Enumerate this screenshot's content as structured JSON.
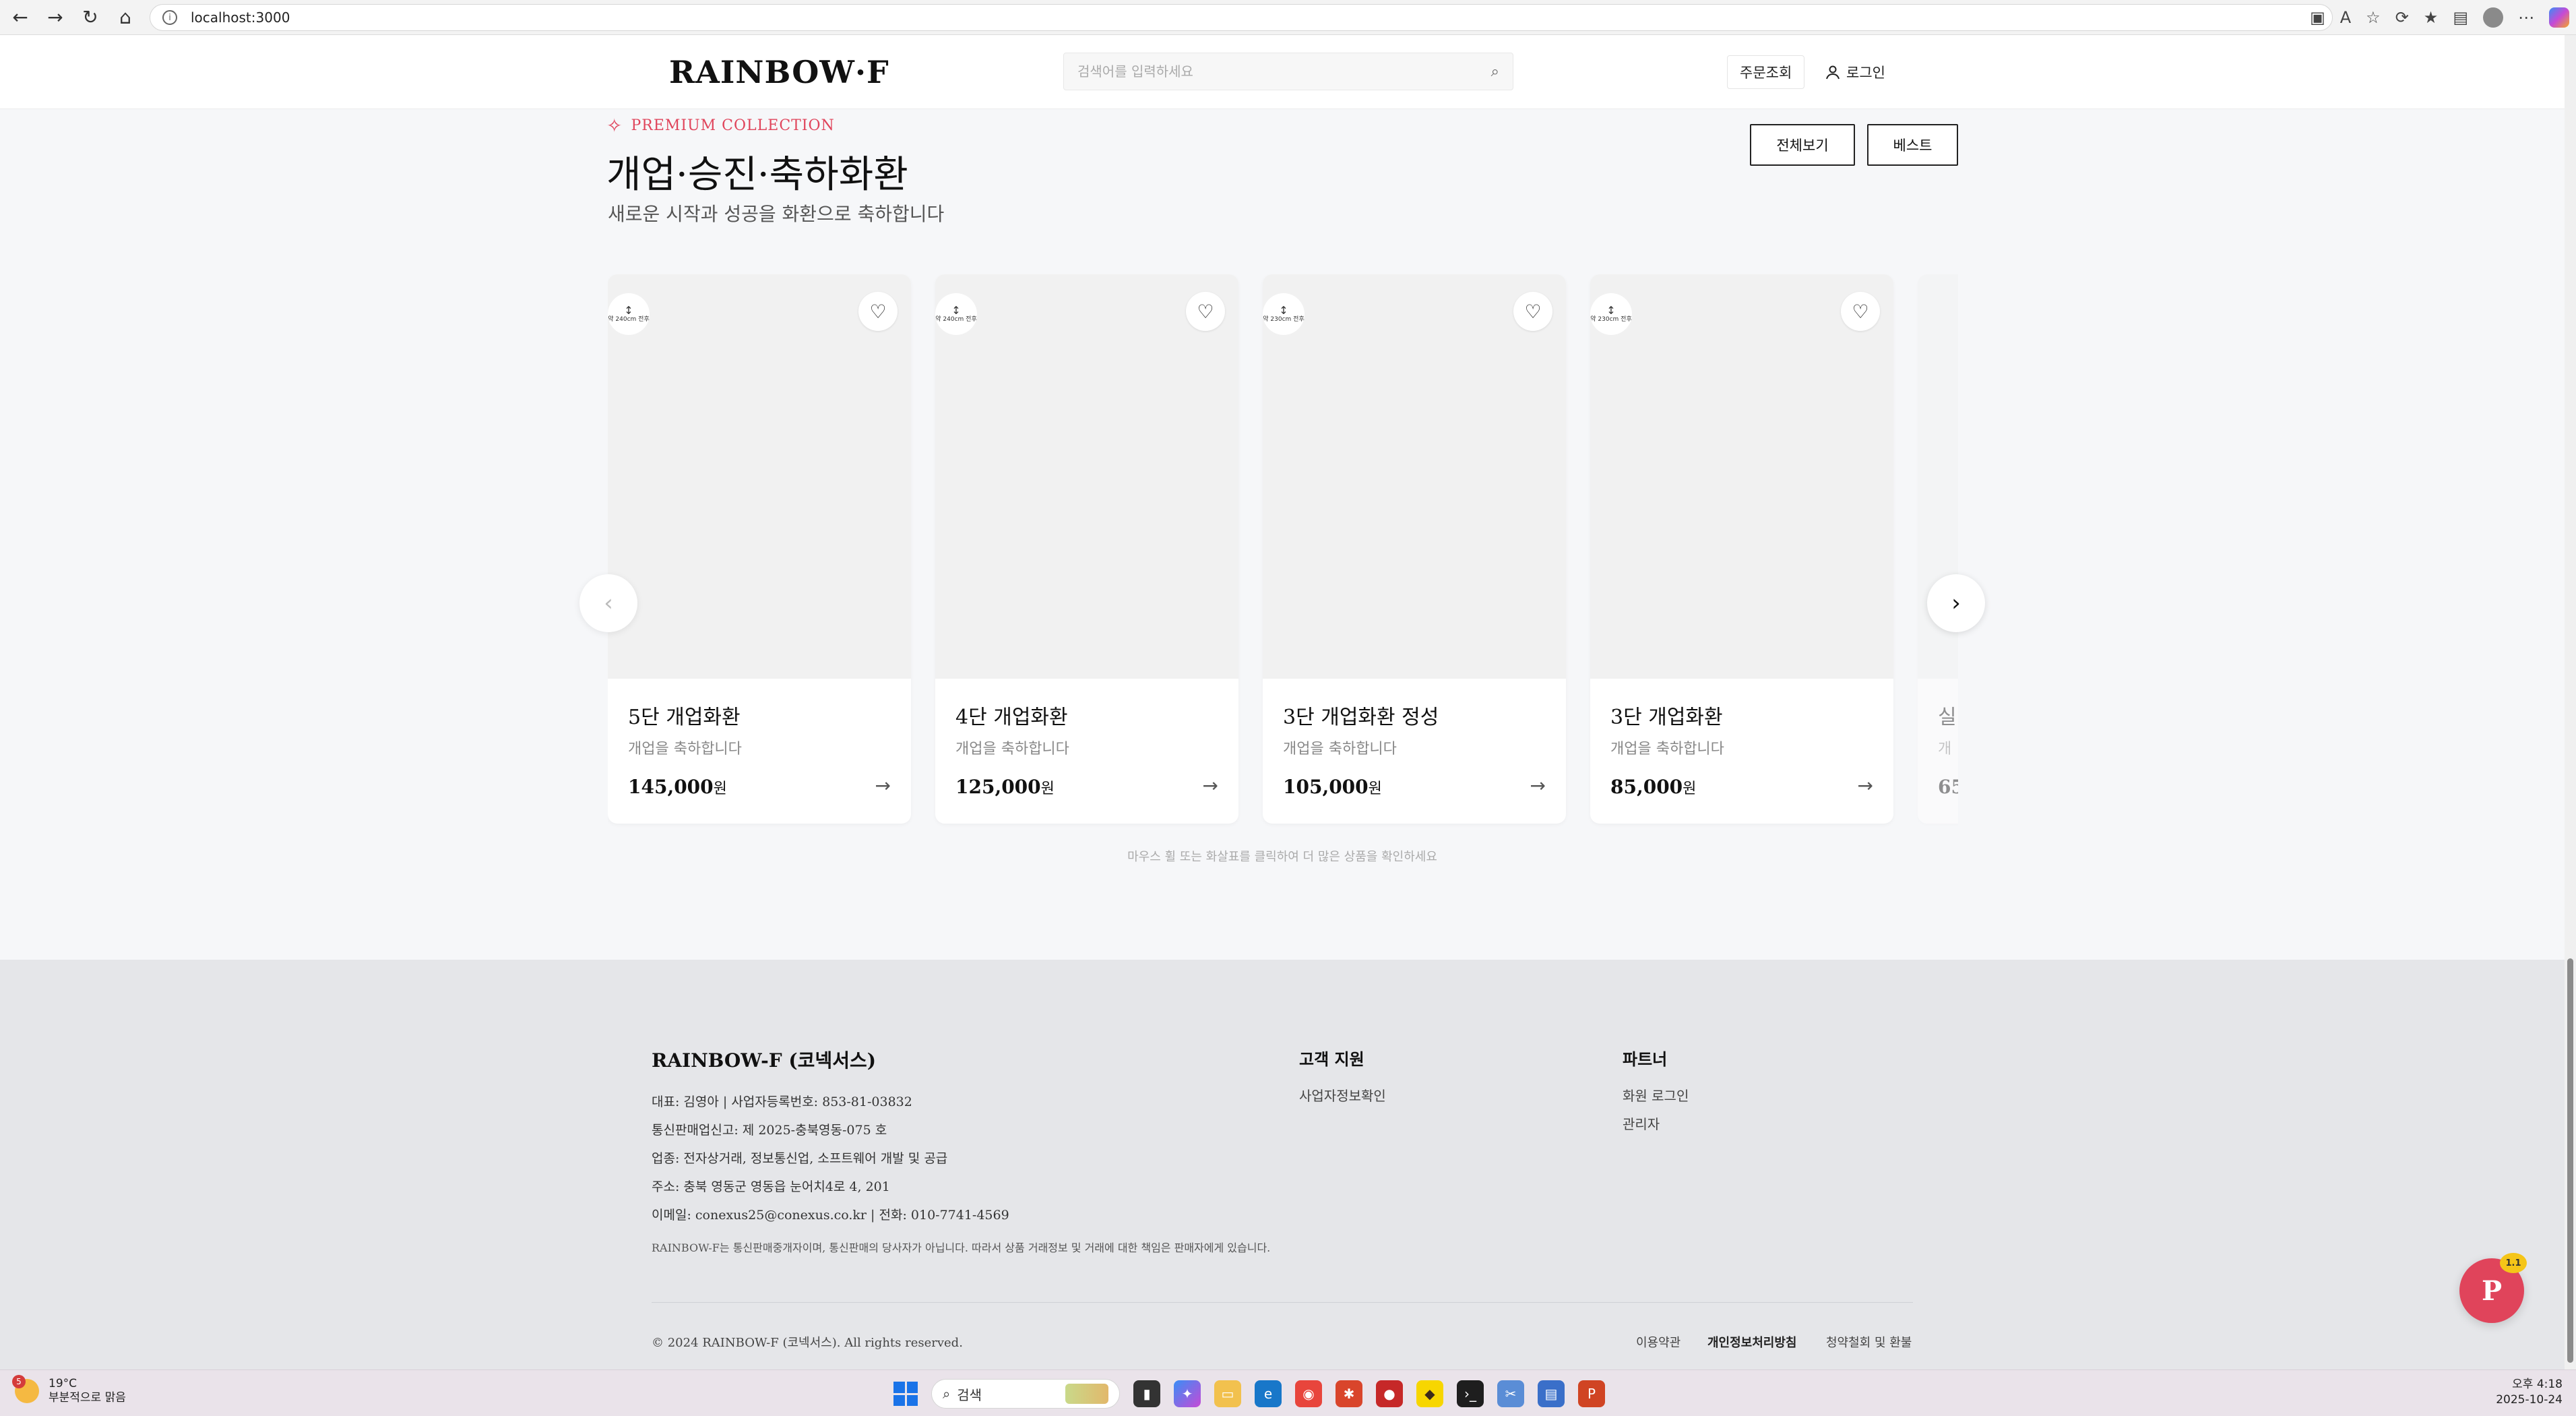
{
  "browser": {
    "url": "localhost:3000"
  },
  "header": {
    "logo": "RAINBOW·F",
    "search_placeholder": "검색어를 입력하세요",
    "orders_label": "주문조회",
    "login_label": "로그인"
  },
  "section": {
    "eyebrow": "PREMIUM COLLECTION",
    "title": "개업·승진·축하화환",
    "subtitle": "새로운 시작과 성공을 화환으로 축하합니다",
    "tab_all": "전체보기",
    "tab_best": "베스트",
    "hint": "마우스 휠 또는 화살표를 클릭하여 더 많은 상품을 확인하세요"
  },
  "products": [
    {
      "badge": "약 240cm 전후",
      "name": "5단 개업화환",
      "desc": "개업을 축하합니다",
      "price": "145,000",
      "currency": "원",
      "tiers": 5
    },
    {
      "badge": "약 240cm 전후",
      "name": "4단 개업화환",
      "desc": "개업을 축하합니다",
      "price": "125,000",
      "currency": "원",
      "tiers": 4
    },
    {
      "badge": "약 230cm 전후",
      "name": "3단 개업화환 정성",
      "desc": "개업을 축하합니다",
      "price": "105,000",
      "currency": "원",
      "tiers": 3
    },
    {
      "badge": "약 230cm 전후",
      "name": "3단 개업화환",
      "desc": "개업을 축하합니다",
      "price": "85,000",
      "currency": "원",
      "tiers": 3
    },
    {
      "badge": "",
      "name": "실",
      "desc": "개",
      "price": "65",
      "currency": "",
      "tiers": 0
    }
  ],
  "footer": {
    "brand": "RAINBOW-F (코넥서스)",
    "lines": [
      "대표: 김영아 | 사업자등록번호: 853-81-03832",
      "통신판매업신고: 제 2025-충북영동-075 호",
      "업종: 전자상거래, 정보통신업, 소프트웨어 개발 및 공급",
      "주소: 충북 영동군 영동읍 눈어치4로 4, 201",
      "이메일: conexus25@conexus.co.kr | 전화: 010-7741-4569"
    ],
    "note": "RAINBOW-F는 통신판매중개자이며, 통신판매의 당사자가 아닙니다. 따라서 상품 거래정보 및 거래에 대한 책임은 판매자에게 있습니다.",
    "support_title": "고객 지원",
    "support_links": [
      "사업자정보확인"
    ],
    "partner_title": "파트너",
    "partner_links": [
      "화원 로그인",
      "관리자"
    ],
    "copyright": "© 2024 RAINBOW-F (코넥서스). All rights reserved.",
    "bottom_links": [
      "이용약관",
      "개인정보처리방침",
      "청약철회 및 환불"
    ]
  },
  "fab": {
    "label": "P",
    "badge": "1.1"
  },
  "taskbar": {
    "weather_badge": "5",
    "temp": "19°C",
    "condition": "부분적으로 맑음",
    "search_label": "검색",
    "time": "오후 4:18",
    "date": "2025-10-24"
  }
}
